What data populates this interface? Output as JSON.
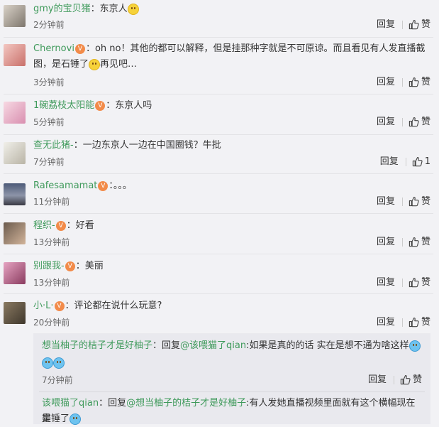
{
  "actions": {
    "reply": "回复",
    "like": "赞"
  },
  "comments": [
    {
      "user": "gmy的宝贝猪",
      "sep": "：",
      "text": "东京人",
      "time": "2分钟前",
      "likes": "赞"
    },
    {
      "user": "Chernovi",
      "sep": "：",
      "text": "oh no！其他的都可以解释，但是挂那种字就是不可原谅。而且看见有人发直播截",
      "text2": "图，是石锤了",
      "text3": "再见吧…",
      "time": "3分钟前",
      "likes": "赞"
    },
    {
      "user": "1碗荔枝太阳能",
      "sep": "：",
      "text": "东京人吗",
      "time": "5分钟前",
      "likes": "赞"
    },
    {
      "user": "查无此猪-",
      "sep": "：",
      "text": "一边东京人一边在中国圈钱？牛批",
      "time": "7分钟前",
      "likes": "1"
    },
    {
      "user": "Rafesamamat",
      "sep": "：",
      "text": "。。。",
      "time": "11分钟前",
      "likes": "赞"
    },
    {
      "user": "程织-",
      "sep": "：",
      "text": "好看",
      "time": "13分钟前",
      "likes": "赞"
    },
    {
      "user": "别跟我-",
      "sep": "：",
      "text": "美丽",
      "time": "13分钟前",
      "likes": "赞"
    },
    {
      "user": "小·L·",
      "sep": "：",
      "text": "评论都在说什么玩意?",
      "time": "20分钟前",
      "likes": "赞"
    }
  ],
  "replies": [
    {
      "user": "想当柚子的桔子才是好柚子",
      "sep": "：",
      "prefix": "回复",
      "mention": "@该喂猫了qian",
      "text": ":如果是真的的话 实在是想不通为啥这样",
      "time": "7分钟前"
    },
    {
      "user": "该喂猫了qian",
      "sep": "：",
      "prefix": "回复",
      "mention": "@想当柚子的桔子才是好柚子",
      "text": ":有人发她直播视频里面就有这个横幅现在是",
      "text2": "实锤了"
    }
  ]
}
